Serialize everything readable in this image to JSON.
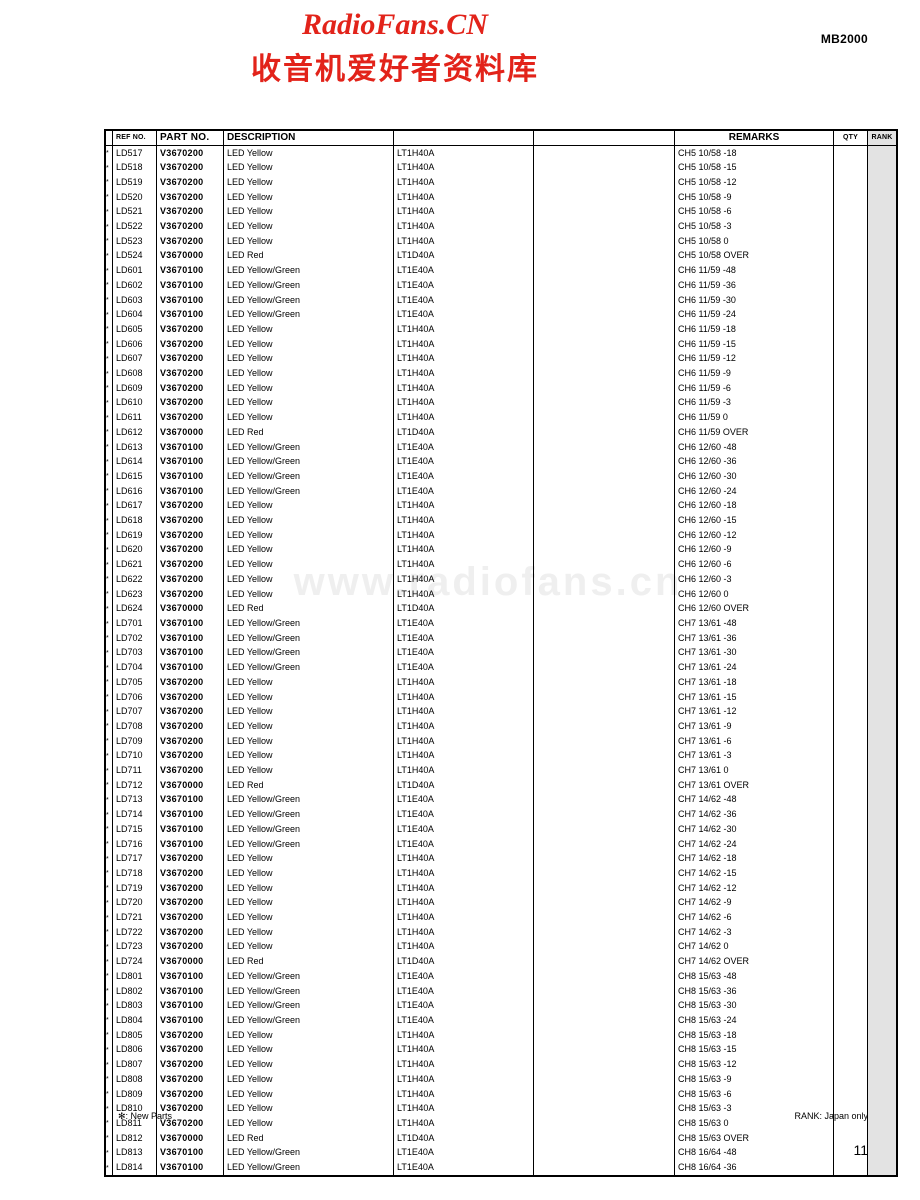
{
  "header": {
    "watermark_latin": "RadioFans.CN",
    "watermark_cjk": "收音机爱好者资料库",
    "model_code": "MB2000"
  },
  "page_watermark": "www.radiofans.cn",
  "table": {
    "columns": [
      {
        "key": "star",
        "label": ""
      },
      {
        "key": "ref",
        "label": "REF NO."
      },
      {
        "key": "part",
        "label": "PART NO."
      },
      {
        "key": "desc",
        "label": "DESCRIPTION"
      },
      {
        "key": "code",
        "label": ""
      },
      {
        "key": "blank",
        "label": ""
      },
      {
        "key": "rem",
        "label": "REMARKS"
      },
      {
        "key": "qty",
        "label": "QTY"
      },
      {
        "key": "rank",
        "label": "RANK"
      }
    ],
    "rows": [
      {
        "star": "*",
        "ref": "LD517",
        "part": "V3670200",
        "desc": "LED Yellow",
        "code": "LT1H40A",
        "blank": "",
        "rem": "CH5 10/58 -18",
        "qty": "",
        "rank": ""
      },
      {
        "star": "*",
        "ref": "LD518",
        "part": "V3670200",
        "desc": "LED Yellow",
        "code": "LT1H40A",
        "blank": "",
        "rem": "CH5 10/58 -15",
        "qty": "",
        "rank": ""
      },
      {
        "star": "*",
        "ref": "LD519",
        "part": "V3670200",
        "desc": "LED Yellow",
        "code": "LT1H40A",
        "blank": "",
        "rem": "CH5 10/58 -12",
        "qty": "",
        "rank": ""
      },
      {
        "star": "*",
        "ref": "LD520",
        "part": "V3670200",
        "desc": "LED Yellow",
        "code": "LT1H40A",
        "blank": "",
        "rem": "CH5 10/58 -9",
        "qty": "",
        "rank": ""
      },
      {
        "star": "*",
        "ref": "LD521",
        "part": "V3670200",
        "desc": "LED Yellow",
        "code": "LT1H40A",
        "blank": "",
        "rem": "CH5 10/58 -6",
        "qty": "",
        "rank": ""
      },
      {
        "star": "*",
        "ref": "LD522",
        "part": "V3670200",
        "desc": "LED Yellow",
        "code": "LT1H40A",
        "blank": "",
        "rem": "CH5 10/58 -3",
        "qty": "",
        "rank": ""
      },
      {
        "star": "*",
        "ref": "LD523",
        "part": "V3670200",
        "desc": "LED Yellow",
        "code": "LT1H40A",
        "blank": "",
        "rem": "CH5 10/58 0",
        "qty": "",
        "rank": ""
      },
      {
        "star": "*",
        "ref": "LD524",
        "part": "V3670000",
        "desc": "LED Red",
        "code": "LT1D40A",
        "blank": "",
        "rem": "CH5 10/58 OVER",
        "qty": "",
        "rank": ""
      },
      {
        "star": "*",
        "ref": "LD601",
        "part": "V3670100",
        "desc": "LED Yellow/Green",
        "code": "LT1E40A",
        "blank": "",
        "rem": "CH6 11/59 -48",
        "qty": "",
        "rank": ""
      },
      {
        "star": "*",
        "ref": "LD602",
        "part": "V3670100",
        "desc": "LED Yellow/Green",
        "code": "LT1E40A",
        "blank": "",
        "rem": "CH6 11/59 -36",
        "qty": "",
        "rank": ""
      },
      {
        "star": "*",
        "ref": "LD603",
        "part": "V3670100",
        "desc": "LED Yellow/Green",
        "code": "LT1E40A",
        "blank": "",
        "rem": "CH6 11/59 -30",
        "qty": "",
        "rank": ""
      },
      {
        "star": "*",
        "ref": "LD604",
        "part": "V3670100",
        "desc": "LED Yellow/Green",
        "code": "LT1E40A",
        "blank": "",
        "rem": "CH6 11/59 -24",
        "qty": "",
        "rank": ""
      },
      {
        "star": "*",
        "ref": "LD605",
        "part": "V3670200",
        "desc": "LED Yellow",
        "code": "LT1H40A",
        "blank": "",
        "rem": "CH6 11/59 -18",
        "qty": "",
        "rank": ""
      },
      {
        "star": "*",
        "ref": "LD606",
        "part": "V3670200",
        "desc": "LED Yellow",
        "code": "LT1H40A",
        "blank": "",
        "rem": "CH6 11/59 -15",
        "qty": "",
        "rank": ""
      },
      {
        "star": "*",
        "ref": "LD607",
        "part": "V3670200",
        "desc": "LED Yellow",
        "code": "LT1H40A",
        "blank": "",
        "rem": "CH6 11/59 -12",
        "qty": "",
        "rank": ""
      },
      {
        "star": "*",
        "ref": "LD608",
        "part": "V3670200",
        "desc": "LED Yellow",
        "code": "LT1H40A",
        "blank": "",
        "rem": "CH6 11/59 -9",
        "qty": "",
        "rank": ""
      },
      {
        "star": "*",
        "ref": "LD609",
        "part": "V3670200",
        "desc": "LED Yellow",
        "code": "LT1H40A",
        "blank": "",
        "rem": "CH6 11/59 -6",
        "qty": "",
        "rank": ""
      },
      {
        "star": "*",
        "ref": "LD610",
        "part": "V3670200",
        "desc": "LED Yellow",
        "code": "LT1H40A",
        "blank": "",
        "rem": "CH6 11/59 -3",
        "qty": "",
        "rank": ""
      },
      {
        "star": "*",
        "ref": "LD611",
        "part": "V3670200",
        "desc": "LED Yellow",
        "code": "LT1H40A",
        "blank": "",
        "rem": "CH6 11/59 0",
        "qty": "",
        "rank": ""
      },
      {
        "star": "*",
        "ref": "LD612",
        "part": "V3670000",
        "desc": "LED Red",
        "code": "LT1D40A",
        "blank": "",
        "rem": "CH6 11/59 OVER",
        "qty": "",
        "rank": ""
      },
      {
        "star": "*",
        "ref": "LD613",
        "part": "V3670100",
        "desc": "LED Yellow/Green",
        "code": "LT1E40A",
        "blank": "",
        "rem": "CH6 12/60 -48",
        "qty": "",
        "rank": ""
      },
      {
        "star": "*",
        "ref": "LD614",
        "part": "V3670100",
        "desc": "LED Yellow/Green",
        "code": "LT1E40A",
        "blank": "",
        "rem": "CH6 12/60 -36",
        "qty": "",
        "rank": ""
      },
      {
        "star": "*",
        "ref": "LD615",
        "part": "V3670100",
        "desc": "LED Yellow/Green",
        "code": "LT1E40A",
        "blank": "",
        "rem": "CH6 12/60 -30",
        "qty": "",
        "rank": ""
      },
      {
        "star": "*",
        "ref": "LD616",
        "part": "V3670100",
        "desc": "LED Yellow/Green",
        "code": "LT1E40A",
        "blank": "",
        "rem": "CH6 12/60 -24",
        "qty": "",
        "rank": ""
      },
      {
        "star": "*",
        "ref": "LD617",
        "part": "V3670200",
        "desc": "LED Yellow",
        "code": "LT1H40A",
        "blank": "",
        "rem": "CH6 12/60 -18",
        "qty": "",
        "rank": ""
      },
      {
        "star": "*",
        "ref": "LD618",
        "part": "V3670200",
        "desc": "LED Yellow",
        "code": "LT1H40A",
        "blank": "",
        "rem": "CH6 12/60 -15",
        "qty": "",
        "rank": ""
      },
      {
        "star": "*",
        "ref": "LD619",
        "part": "V3670200",
        "desc": "LED Yellow",
        "code": "LT1H40A",
        "blank": "",
        "rem": "CH6 12/60 -12",
        "qty": "",
        "rank": ""
      },
      {
        "star": "*",
        "ref": "LD620",
        "part": "V3670200",
        "desc": "LED Yellow",
        "code": "LT1H40A",
        "blank": "",
        "rem": "CH6 12/60 -9",
        "qty": "",
        "rank": ""
      },
      {
        "star": "*",
        "ref": "LD621",
        "part": "V3670200",
        "desc": "LED Yellow",
        "code": "LT1H40A",
        "blank": "",
        "rem": "CH6 12/60 -6",
        "qty": "",
        "rank": ""
      },
      {
        "star": "*",
        "ref": "LD622",
        "part": "V3670200",
        "desc": "LED Yellow",
        "code": "LT1H40A",
        "blank": "",
        "rem": "CH6 12/60 -3",
        "qty": "",
        "rank": ""
      },
      {
        "star": "*",
        "ref": "LD623",
        "part": "V3670200",
        "desc": "LED Yellow",
        "code": "LT1H40A",
        "blank": "",
        "rem": "CH6 12/60 0",
        "qty": "",
        "rank": ""
      },
      {
        "star": "*",
        "ref": "LD624",
        "part": "V3670000",
        "desc": "LED Red",
        "code": "LT1D40A",
        "blank": "",
        "rem": "CH6 12/60 OVER",
        "qty": "",
        "rank": ""
      },
      {
        "star": "*",
        "ref": "LD701",
        "part": "V3670100",
        "desc": "LED Yellow/Green",
        "code": "LT1E40A",
        "blank": "",
        "rem": "CH7 13/61 -48",
        "qty": "",
        "rank": ""
      },
      {
        "star": "*",
        "ref": "LD702",
        "part": "V3670100",
        "desc": "LED Yellow/Green",
        "code": "LT1E40A",
        "blank": "",
        "rem": "CH7 13/61 -36",
        "qty": "",
        "rank": ""
      },
      {
        "star": "*",
        "ref": "LD703",
        "part": "V3670100",
        "desc": "LED Yellow/Green",
        "code": "LT1E40A",
        "blank": "",
        "rem": "CH7 13/61 -30",
        "qty": "",
        "rank": ""
      },
      {
        "star": "*",
        "ref": "LD704",
        "part": "V3670100",
        "desc": "LED Yellow/Green",
        "code": "LT1E40A",
        "blank": "",
        "rem": "CH7 13/61 -24",
        "qty": "",
        "rank": ""
      },
      {
        "star": "*",
        "ref": "LD705",
        "part": "V3670200",
        "desc": "LED Yellow",
        "code": "LT1H40A",
        "blank": "",
        "rem": "CH7 13/61 -18",
        "qty": "",
        "rank": ""
      },
      {
        "star": "*",
        "ref": "LD706",
        "part": "V3670200",
        "desc": "LED Yellow",
        "code": "LT1H40A",
        "blank": "",
        "rem": "CH7 13/61 -15",
        "qty": "",
        "rank": ""
      },
      {
        "star": "*",
        "ref": "LD707",
        "part": "V3670200",
        "desc": "LED Yellow",
        "code": "LT1H40A",
        "blank": "",
        "rem": "CH7 13/61 -12",
        "qty": "",
        "rank": ""
      },
      {
        "star": "*",
        "ref": "LD708",
        "part": "V3670200",
        "desc": "LED Yellow",
        "code": "LT1H40A",
        "blank": "",
        "rem": "CH7 13/61 -9",
        "qty": "",
        "rank": ""
      },
      {
        "star": "*",
        "ref": "LD709",
        "part": "V3670200",
        "desc": "LED Yellow",
        "code": "LT1H40A",
        "blank": "",
        "rem": "CH7 13/61 -6",
        "qty": "",
        "rank": ""
      },
      {
        "star": "*",
        "ref": "LD710",
        "part": "V3670200",
        "desc": "LED Yellow",
        "code": "LT1H40A",
        "blank": "",
        "rem": "CH7 13/61 -3",
        "qty": "",
        "rank": ""
      },
      {
        "star": "*",
        "ref": "LD711",
        "part": "V3670200",
        "desc": "LED Yellow",
        "code": "LT1H40A",
        "blank": "",
        "rem": "CH7 13/61 0",
        "qty": "",
        "rank": ""
      },
      {
        "star": "*",
        "ref": "LD712",
        "part": "V3670000",
        "desc": "LED Red",
        "code": "LT1D40A",
        "blank": "",
        "rem": "CH7 13/61 OVER",
        "qty": "",
        "rank": ""
      },
      {
        "star": "*",
        "ref": "LD713",
        "part": "V3670100",
        "desc": "LED Yellow/Green",
        "code": "LT1E40A",
        "blank": "",
        "rem": "CH7 14/62 -48",
        "qty": "",
        "rank": ""
      },
      {
        "star": "*",
        "ref": "LD714",
        "part": "V3670100",
        "desc": "LED Yellow/Green",
        "code": "LT1E40A",
        "blank": "",
        "rem": "CH7 14/62 -36",
        "qty": "",
        "rank": ""
      },
      {
        "star": "*",
        "ref": "LD715",
        "part": "V3670100",
        "desc": "LED Yellow/Green",
        "code": "LT1E40A",
        "blank": "",
        "rem": "CH7 14/62 -30",
        "qty": "",
        "rank": ""
      },
      {
        "star": "*",
        "ref": "LD716",
        "part": "V3670100",
        "desc": "LED Yellow/Green",
        "code": "LT1E40A",
        "blank": "",
        "rem": "CH7 14/62 -24",
        "qty": "",
        "rank": ""
      },
      {
        "star": "*",
        "ref": "LD717",
        "part": "V3670200",
        "desc": "LED Yellow",
        "code": "LT1H40A",
        "blank": "",
        "rem": "CH7 14/62 -18",
        "qty": "",
        "rank": ""
      },
      {
        "star": "*",
        "ref": "LD718",
        "part": "V3670200",
        "desc": "LED Yellow",
        "code": "LT1H40A",
        "blank": "",
        "rem": "CH7 14/62 -15",
        "qty": "",
        "rank": ""
      },
      {
        "star": "*",
        "ref": "LD719",
        "part": "V3670200",
        "desc": "LED Yellow",
        "code": "LT1H40A",
        "blank": "",
        "rem": "CH7 14/62 -12",
        "qty": "",
        "rank": ""
      },
      {
        "star": "*",
        "ref": "LD720",
        "part": "V3670200",
        "desc": "LED Yellow",
        "code": "LT1H40A",
        "blank": "",
        "rem": "CH7 14/62 -9",
        "qty": "",
        "rank": ""
      },
      {
        "star": "*",
        "ref": "LD721",
        "part": "V3670200",
        "desc": "LED Yellow",
        "code": "LT1H40A",
        "blank": "",
        "rem": "CH7 14/62 -6",
        "qty": "",
        "rank": ""
      },
      {
        "star": "*",
        "ref": "LD722",
        "part": "V3670200",
        "desc": "LED Yellow",
        "code": "LT1H40A",
        "blank": "",
        "rem": "CH7 14/62 -3",
        "qty": "",
        "rank": ""
      },
      {
        "star": "*",
        "ref": "LD723",
        "part": "V3670200",
        "desc": "LED Yellow",
        "code": "LT1H40A",
        "blank": "",
        "rem": "CH7 14/62 0",
        "qty": "",
        "rank": ""
      },
      {
        "star": "*",
        "ref": "LD724",
        "part": "V3670000",
        "desc": "LED Red",
        "code": "LT1D40A",
        "blank": "",
        "rem": "CH7 14/62 OVER",
        "qty": "",
        "rank": ""
      },
      {
        "star": "*",
        "ref": "LD801",
        "part": "V3670100",
        "desc": "LED Yellow/Green",
        "code": "LT1E40A",
        "blank": "",
        "rem": "CH8 15/63 -48",
        "qty": "",
        "rank": ""
      },
      {
        "star": "*",
        "ref": "LD802",
        "part": "V3670100",
        "desc": "LED Yellow/Green",
        "code": "LT1E40A",
        "blank": "",
        "rem": "CH8 15/63 -36",
        "qty": "",
        "rank": ""
      },
      {
        "star": "*",
        "ref": "LD803",
        "part": "V3670100",
        "desc": "LED Yellow/Green",
        "code": "LT1E40A",
        "blank": "",
        "rem": "CH8 15/63 -30",
        "qty": "",
        "rank": ""
      },
      {
        "star": "*",
        "ref": "LD804",
        "part": "V3670100",
        "desc": "LED Yellow/Green",
        "code": "LT1E40A",
        "blank": "",
        "rem": "CH8 15/63 -24",
        "qty": "",
        "rank": ""
      },
      {
        "star": "*",
        "ref": "LD805",
        "part": "V3670200",
        "desc": "LED Yellow",
        "code": "LT1H40A",
        "blank": "",
        "rem": "CH8 15/63 -18",
        "qty": "",
        "rank": ""
      },
      {
        "star": "*",
        "ref": "LD806",
        "part": "V3670200",
        "desc": "LED Yellow",
        "code": "LT1H40A",
        "blank": "",
        "rem": "CH8 15/63 -15",
        "qty": "",
        "rank": ""
      },
      {
        "star": "*",
        "ref": "LD807",
        "part": "V3670200",
        "desc": "LED Yellow",
        "code": "LT1H40A",
        "blank": "",
        "rem": "CH8 15/63 -12",
        "qty": "",
        "rank": ""
      },
      {
        "star": "*",
        "ref": "LD808",
        "part": "V3670200",
        "desc": "LED Yellow",
        "code": "LT1H40A",
        "blank": "",
        "rem": "CH8 15/63 -9",
        "qty": "",
        "rank": ""
      },
      {
        "star": "*",
        "ref": "LD809",
        "part": "V3670200",
        "desc": "LED Yellow",
        "code": "LT1H40A",
        "blank": "",
        "rem": "CH8 15/63 -6",
        "qty": "",
        "rank": ""
      },
      {
        "star": "*",
        "ref": "LD810",
        "part": "V3670200",
        "desc": "LED Yellow",
        "code": "LT1H40A",
        "blank": "",
        "rem": "CH8 15/63 -3",
        "qty": "",
        "rank": ""
      },
      {
        "star": "*",
        "ref": "LD811",
        "part": "V3670200",
        "desc": "LED Yellow",
        "code": "LT1H40A",
        "blank": "",
        "rem": "CH8 15/63 0",
        "qty": "",
        "rank": ""
      },
      {
        "star": "*",
        "ref": "LD812",
        "part": "V3670000",
        "desc": "LED Red",
        "code": "LT1D40A",
        "blank": "",
        "rem": "CH8 15/63 OVER",
        "qty": "",
        "rank": ""
      },
      {
        "star": "*",
        "ref": "LD813",
        "part": "V3670100",
        "desc": "LED Yellow/Green",
        "code": "LT1E40A",
        "blank": "",
        "rem": "CH8 16/64 -48",
        "qty": "",
        "rank": ""
      },
      {
        "star": "*",
        "ref": "LD814",
        "part": "V3670100",
        "desc": "LED Yellow/Green",
        "code": "LT1E40A",
        "blank": "",
        "rem": "CH8 16/64 -36",
        "qty": "",
        "rank": ""
      }
    ]
  },
  "footer": {
    "new_parts_note": "✻: New Parts",
    "rank_note": "RANK: Japan only",
    "page_number": "11"
  },
  "colors": {
    "watermark_red": "#e2231a",
    "rank_column_fill": "#e3e3e3",
    "page_watermark_grey": "#efefef"
  }
}
